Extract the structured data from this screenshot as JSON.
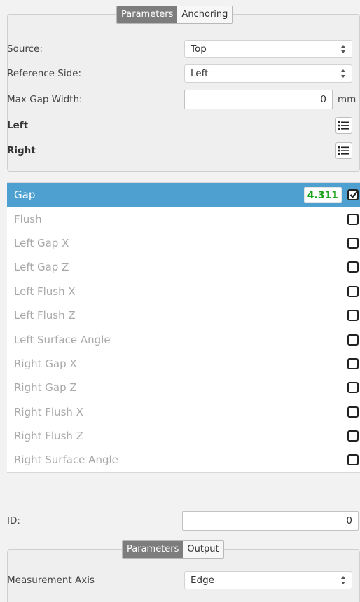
{
  "top_tabs": [
    "Parameters",
    "Anchoring"
  ],
  "parameters": {
    "source_label": "Source:",
    "source_value": "Top",
    "reference_label": "Reference Side:",
    "reference_value": "Left",
    "max_gap_label": "Max Gap Width:",
    "max_gap_value": "0",
    "max_gap_unit": "mm",
    "left_label": "Left",
    "right_label": "Right"
  },
  "measurements": [
    {
      "label": "Gap",
      "checked": true,
      "selected": true,
      "value": "4.311"
    },
    {
      "label": "Flush",
      "checked": false
    },
    {
      "label": "Left Gap X",
      "checked": false
    },
    {
      "label": "Left Gap Z",
      "checked": false
    },
    {
      "label": "Left Flush X",
      "checked": false
    },
    {
      "label": "Left Flush Z",
      "checked": false
    },
    {
      "label": "Left Surface Angle",
      "checked": false
    },
    {
      "label": "Right Gap X",
      "checked": false
    },
    {
      "label": "Right Gap Z",
      "checked": false
    },
    {
      "label": "Right Flush X",
      "checked": false
    },
    {
      "label": "Right Flush Z",
      "checked": false
    },
    {
      "label": "Right Surface Angle",
      "checked": false
    }
  ],
  "id_field": {
    "label": "ID:",
    "value": "0"
  },
  "bottom_tabs": [
    "Parameters",
    "Output"
  ],
  "output": {
    "axis_label": "Measurement Axis",
    "axis_value": "Edge"
  },
  "colors": {
    "selected_row": "#4da0d0",
    "value_text": "#1aa31a",
    "active_tab": "#7d7d7d"
  },
  "icons": {
    "select_arrows": "updown-arrows-icon",
    "list_button": "list-icon",
    "checkbox": "checkbox-icon"
  }
}
